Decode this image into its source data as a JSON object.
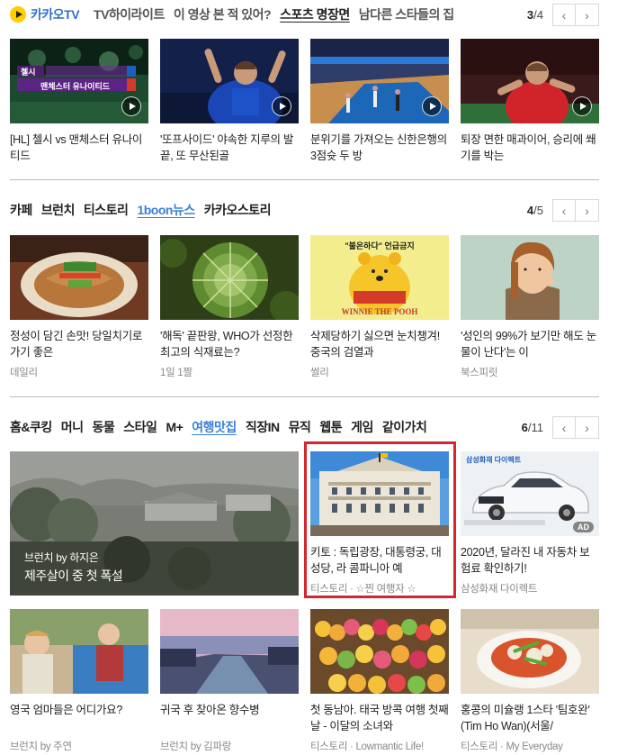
{
  "tv": {
    "logo": "카카오TV",
    "tabs": [
      "TV하이라이트",
      "이 영상 본 적 있어?",
      "스포츠 명장면",
      "남다른 스타들의 집"
    ],
    "page": "3",
    "total": "/4",
    "cards": [
      {
        "title": "[HL] 첼시 vs 맨체스터 유나이티드",
        "caption1": "첼시",
        "caption2": "맨체스터 유나이티드"
      },
      {
        "title": "'또프사이드' 야속한 지루의 발끝, 또 무산된골"
      },
      {
        "title": "분위기를 가져오는 신한은행의 3점슛 두 방"
      },
      {
        "title": "퇴장 면한 매과이어, 승리에 쐐기를 박는"
      }
    ]
  },
  "cafe": {
    "tabs": [
      "카페",
      "브런치",
      "티스토리",
      "1boon뉴스",
      "카카오스토리"
    ],
    "page": "4",
    "total": "/5",
    "cards": [
      {
        "title": "정성이 담긴 손맛! 당일치기로 가기 좋은",
        "source": "데일리"
      },
      {
        "title": "'해독' 끝판왕, WHO가 선정한 최고의 식재료는?",
        "source": "1일 1짤"
      },
      {
        "title": "삭제당하기 싫으면 눈치챙겨! 중국의 검열과",
        "source": "썰리",
        "badge": "\"불온하다\" 언급금지",
        "pooh": "WINNIE THE POOH"
      },
      {
        "title": "'성인의 99%가 보기만 해도 눈물이 난다'는 이",
        "source": "북스피릿"
      }
    ]
  },
  "home": {
    "tabs": [
      "홈&쿠킹",
      "머니",
      "동물",
      "스타일",
      "M+",
      "여행맛집",
      "직장IN",
      "뮤직",
      "웹툰",
      "게임",
      "같이가치"
    ],
    "page": "6",
    "total": "/11",
    "big": {
      "source": "브런치 by 하지은",
      "title": "제주살이 중 첫 폭설"
    },
    "kito": {
      "title": "키토 : 독립광장, 대통령궁, 대성당, 라 콤파니아 예",
      "source": "티스토리 · ☆찐 여행자 ☆"
    },
    "ad": {
      "title": "2020년, 달라진 내 자동차 보험료 확인하기!",
      "source": "삼성화재 다이렉트",
      "brand": "삼성화재 다이렉트",
      "badge": "AD"
    },
    "cards": [
      {
        "title": "영국 엄마들은 어디가요?",
        "source": "브런치 by 주연"
      },
      {
        "title": "귀국 후 찾아온 향수병",
        "source": "브런치 by 김파랑"
      },
      {
        "title": "첫 동남아. 태국 방콕 여행 첫째 날 - 이달의 소녀와",
        "source": "티스토리 · Lowmantic Life!"
      },
      {
        "title": "홍콩의 미슐랭 1스타 '팀호완' (Tim Ho Wan)(서울/",
        "source": "티스토리 · My Everyday"
      }
    ]
  },
  "colors": {
    "accent": "#3b7fd8",
    "highlight": "#d4262c",
    "logo": "#ffcd00"
  }
}
